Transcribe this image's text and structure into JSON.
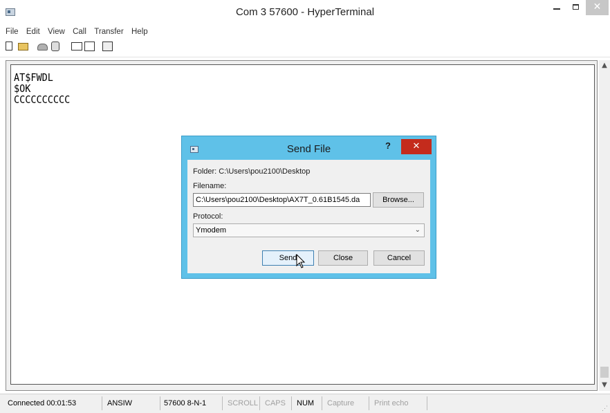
{
  "window": {
    "title": "Com 3 57600 - HyperTerminal",
    "close_glyph": "✕"
  },
  "menu": {
    "items": [
      "File",
      "Edit",
      "View",
      "Call",
      "Transfer",
      "Help"
    ]
  },
  "toolbar": {
    "icons": [
      "new-icon",
      "open-icon",
      "call-icon",
      "disconnect-icon",
      "send-icon",
      "receive-icon",
      "properties-icon"
    ]
  },
  "terminal": {
    "lines": [
      "AT$FWDL",
      "$OK",
      "CCCCCCCCCC"
    ]
  },
  "dialog": {
    "title": "Send File",
    "help_glyph": "?",
    "close_glyph": "✕",
    "folder_text": "Folder: C:\\Users\\pou2100\\Desktop",
    "filename_label": "Filename:",
    "filename_value": "C:\\Users\\pou2100\\Desktop\\AX7T_0.61B1545.da",
    "browse_label": "Browse...",
    "protocol_label": "Protocol:",
    "protocol_value": "Ymodem",
    "send_label": "Send",
    "close_label": "Close",
    "cancel_label": "Cancel"
  },
  "status": {
    "connected": "Connected 00:01:53",
    "emulation": "ANSIW",
    "settings": "57600 8-N-1",
    "scroll": "SCROLL",
    "caps": "CAPS",
    "num": "NUM",
    "capture": "Capture",
    "print_echo": "Print echo"
  }
}
